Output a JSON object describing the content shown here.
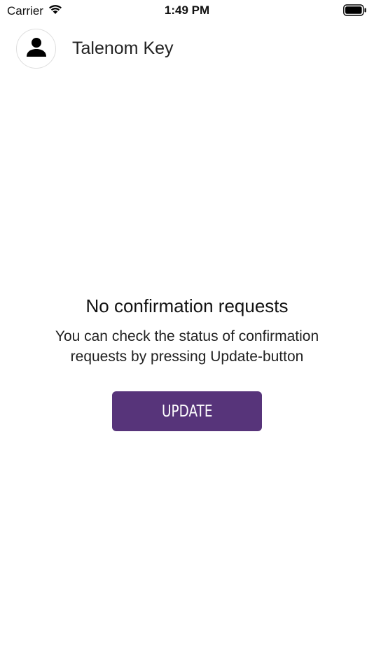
{
  "status_bar": {
    "carrier": "Carrier",
    "time": "1:49 PM",
    "icons": [
      "wifi-icon",
      "battery-icon"
    ]
  },
  "header": {
    "avatar_icon": "person-icon",
    "title": "Talenom Key"
  },
  "empty_state": {
    "title": "No confirmation requests",
    "message": "You can check the status of confirmation requests by pressing Update-button",
    "button_label": "UPDATE"
  },
  "colors": {
    "accent": "#57347a",
    "background": "#ffffff",
    "text": "#111111"
  }
}
